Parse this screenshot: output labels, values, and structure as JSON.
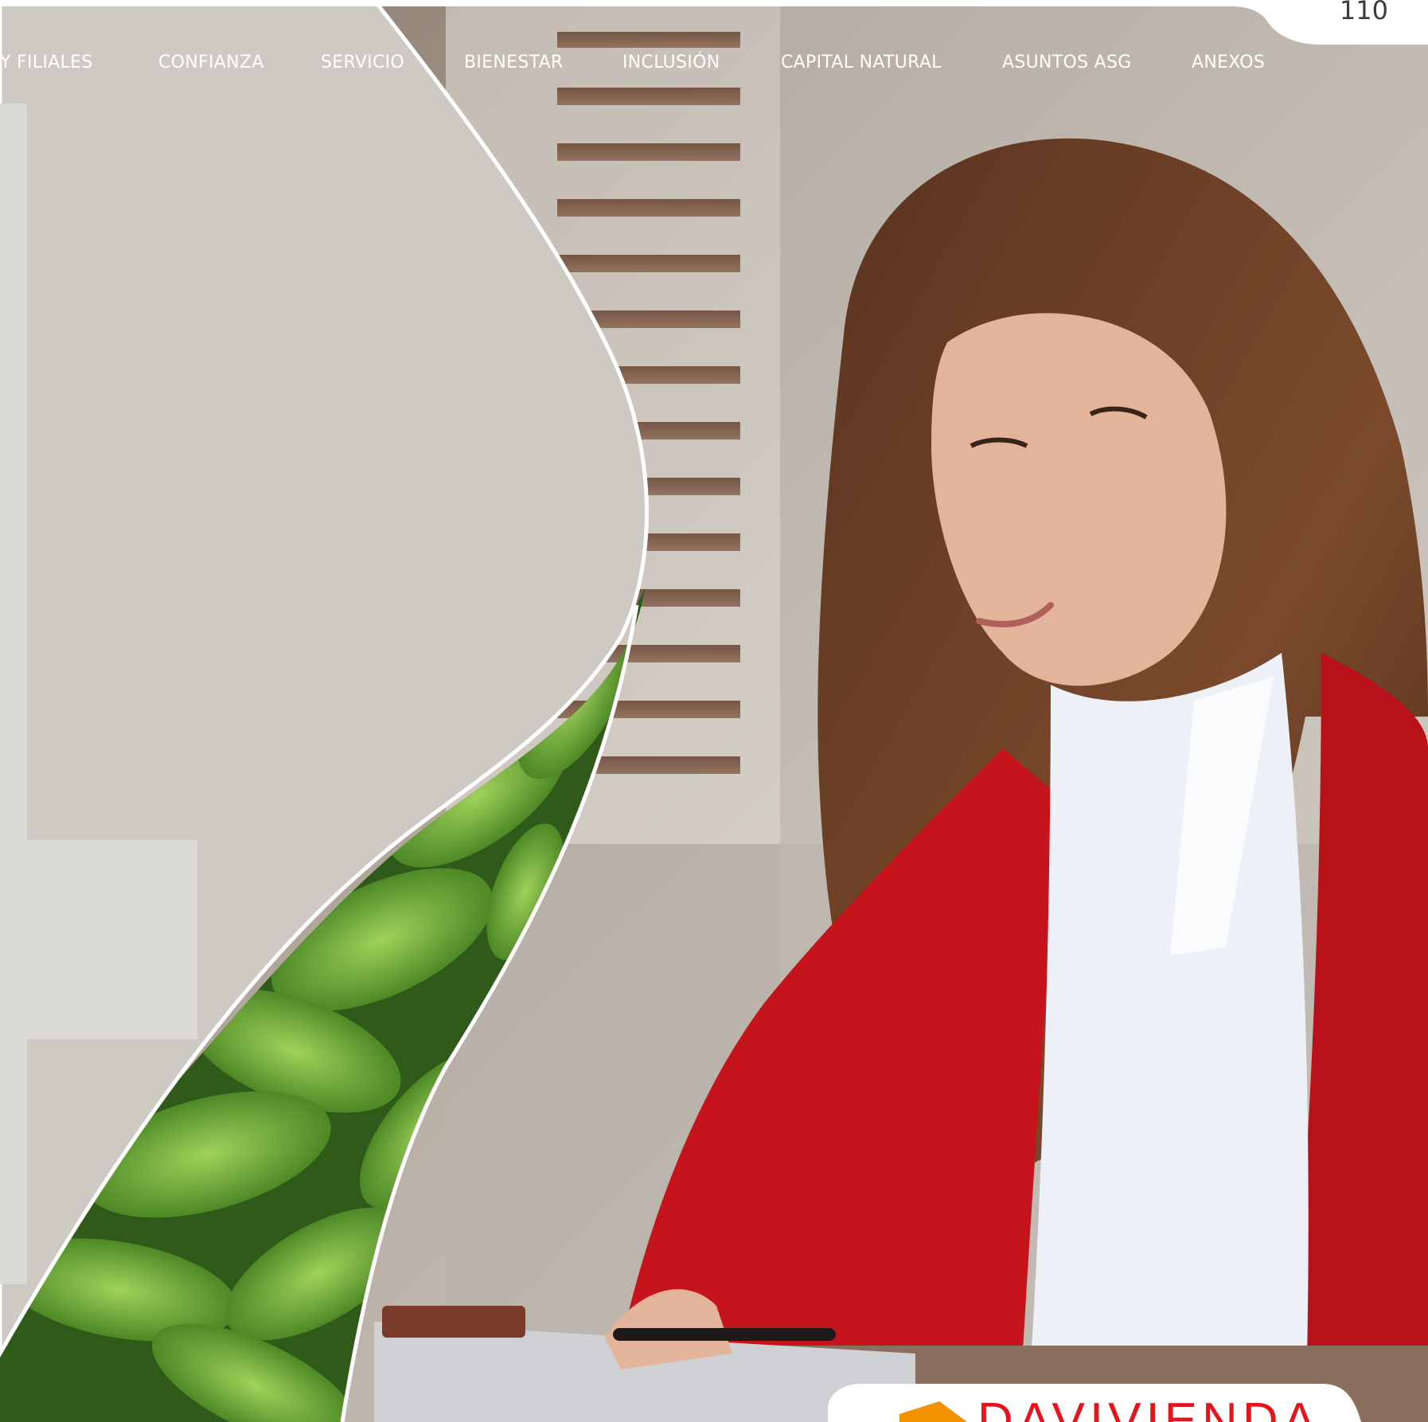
{
  "page_number": "110",
  "nav": {
    "items": [
      {
        "label": "Y FILIALES"
      },
      {
        "label": "CONFIANZA"
      },
      {
        "label": "SERVICIO"
      },
      {
        "label": "BIENESTAR"
      },
      {
        "label": "INCLUSIÓN"
      },
      {
        "label": "CAPITAL NATURAL"
      },
      {
        "label": "ASUNTOS ASG"
      },
      {
        "label": "ANEXOS"
      }
    ]
  },
  "logo": {
    "text": "DAVIVIENDA"
  },
  "colors": {
    "panel": "#cdc9c3",
    "panel_light": "#dcdad6",
    "brand_red": "#e3141b",
    "jacket_red": "#c5141b",
    "leaf_green": "#5c9a2a"
  }
}
